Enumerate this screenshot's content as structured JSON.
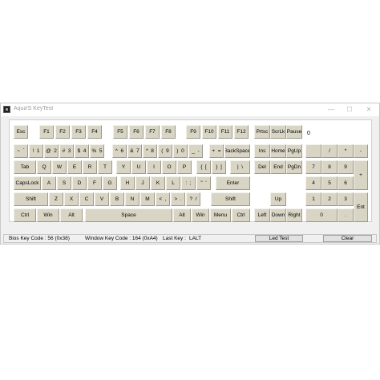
{
  "window": {
    "title": "Aqua'S KeyTest",
    "minimize_glyph": "—",
    "maximize_glyph": "☐",
    "close_glyph": "✕"
  },
  "indicator": "0",
  "keys": {
    "esc": "Esc",
    "f1": "F1",
    "f2": "F2",
    "f3": "F3",
    "f4": "F4",
    "f5": "F5",
    "f6": "F6",
    "f7": "F7",
    "f8": "F8",
    "f9": "F9",
    "f10": "F10",
    "f11": "F11",
    "f12": "F12",
    "prtsc": "Prtsc",
    "scrlk": "ScrLk",
    "pause": "Pause",
    "tilde": "~  `",
    "n1": "!  1",
    "n2": "@  2",
    "n3": "#  3",
    "n4": "$  4",
    "n5": "%  5",
    "n6": "^  6",
    "n7": "&  7",
    "n8": "*  8",
    "n9": "(  9",
    "n0": ")  0",
    "minus": "_  -",
    "equal": "+  =",
    "backspace": "BackSpace",
    "ins": "Ins",
    "home": "Home",
    "pgup": "PgUp",
    "numlock": "",
    "numdiv": "/",
    "nummul": "*",
    "numsub": "-",
    "tab": "Tab",
    "q": "Q",
    "w": "W",
    "e": "E",
    "r": "R",
    "t": "T",
    "y": "Y",
    "u": "U",
    "i": "I",
    "o": "O",
    "p": "P",
    "lbracket": "{  [",
    "rbracket": "}  ]",
    "backslash": "|  \\",
    "del": "Del",
    "end": "End",
    "pgdn": "PgDn",
    "num7": "7",
    "num8": "8",
    "num9": "9",
    "numadd": "+",
    "capslock": "CapsLock",
    "a": "A",
    "s": "S",
    "d": "D",
    "f": "F",
    "g": "G",
    "h": "H",
    "j": "J",
    "k": "K",
    "l": "L",
    "semicolon": ":  ;",
    "quote": "\"  '",
    "enter": "Enter",
    "num4": "4",
    "num5": "5",
    "num6": "6",
    "lshift": "Shift",
    "z": "Z",
    "x": "X",
    "c": "C",
    "v": "V",
    "b": "B",
    "n": "N",
    "m": "M",
    "comma": "<  ,",
    "period": ">  .",
    "slash": "?  /",
    "rshift": "Shift",
    "up": "Up",
    "num1": "1",
    "num2": "2",
    "num3": "3",
    "numenter": "Ent",
    "lctrl": "Ctrl",
    "lwin": "Win",
    "lalt": "Alt",
    "space": "Space",
    "ralt": "Alt",
    "rwin": "Win",
    "menu": "Menu",
    "rctrl": "Ctrl",
    "left": "Left",
    "down": "Down",
    "right": "Right",
    "num0": "0",
    "numdot": "."
  },
  "status": {
    "bios_label": "Bios Key Code : 56 (0x38)",
    "window_label": "Window Key Code : 164 (0xA4)",
    "last_key_label": "Last Key :",
    "last_key_value": "LALT",
    "led_test_button": "Led Test",
    "clear_button": "Clear"
  },
  "colors": {
    "key_face": "#d9d5c5",
    "last_key_value": "#e00000"
  }
}
